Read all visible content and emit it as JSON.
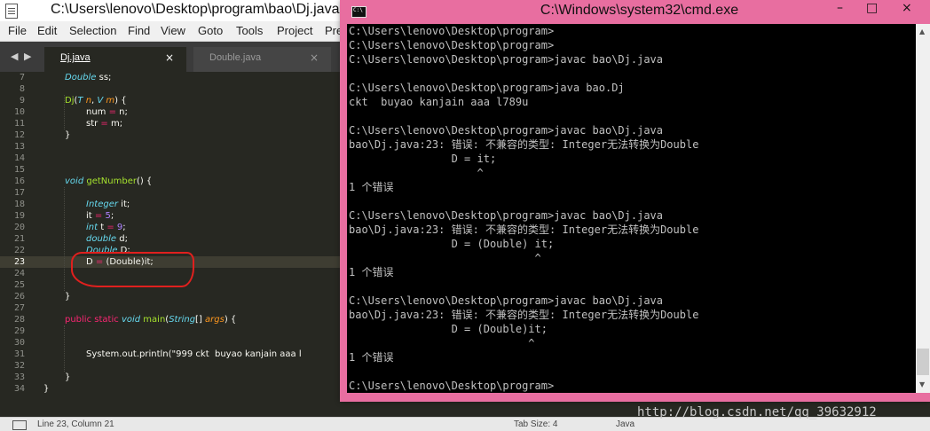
{
  "sublime": {
    "title": "C:\\Users\\lenovo\\Desktop\\program\\bao\\Dj.java",
    "menu": [
      "File",
      "Edit",
      "Selection",
      "Find",
      "View",
      "Goto",
      "Tools",
      "Project",
      "Pre"
    ],
    "tab_nav_left": "◀",
    "tab_nav_right": "▶",
    "tabs": [
      {
        "label": "Dj.java",
        "close": "×"
      },
      {
        "label": "Double.java",
        "close": "×"
      }
    ],
    "line_numbers": [
      "7",
      "8",
      "9",
      "10",
      "11",
      "12",
      "13",
      "14",
      "15",
      "16",
      "17",
      "18",
      "19",
      "20",
      "21",
      "22",
      "23",
      "24",
      "25",
      "26",
      "27",
      "28",
      "29",
      "30",
      "31",
      "32",
      "33",
      "34"
    ],
    "current_line": "23",
    "status": {
      "position": "Line 23, Column 21",
      "tab_size": "Tab Size: 4",
      "syntax": "Java"
    }
  },
  "code": {
    "l7_type": "Double",
    "l7_rest": " ss;",
    "l9_fn": "Dj",
    "l9_p1": "(",
    "l9_t1": "T",
    "l9_a1": "n",
    "l9_p2": ", ",
    "l9_t2": "V",
    "l9_a2": "m",
    "l9_p3": ") {",
    "l10_a": "num ",
    "l10_op": "=",
    "l10_b": " n;",
    "l11_a": "str ",
    "l11_op": "=",
    "l11_b": " m;",
    "l12": "}",
    "l16_kw": "void",
    "l16_fn": "getNumber",
    "l16_rest": "() {",
    "l18_type": "Integer",
    "l18_rest": " it;",
    "l19_a": "it ",
    "l19_op": "=",
    "l19_num": "5",
    "l19_b": ";",
    "l20_kw": "int",
    "l20_a": " t ",
    "l20_op": "=",
    "l20_num": "9",
    "l20_b": ";",
    "l21_kw": "double",
    "l21_rest": " d;",
    "l22_type": "Double",
    "l22_rest": " D;",
    "l23_a": "D ",
    "l23_op": "=",
    "l23_b": " (Double)it;",
    "l26": "}",
    "l28_kw1": "public",
    "l28_kw2": "static",
    "l28_kw3": "void",
    "l28_fn": "main",
    "l28_p1": "(",
    "l28_type": "String",
    "l28_p2": "[] ",
    "l28_arg": "args",
    "l28_p3": ") {",
    "l31": "System.out.println(\"999 ckt  buyao kanjain aaa l",
    "l33": "}",
    "l34": "}"
  },
  "cmd": {
    "title": "C:\\Windows\\system32\\cmd.exe",
    "minimize": "–",
    "maximize": "□",
    "close": "×",
    "lines": [
      "C:\\Users\\lenovo\\Desktop\\program>",
      "C:\\Users\\lenovo\\Desktop\\program>",
      "C:\\Users\\lenovo\\Desktop\\program>javac bao\\Dj.java",
      "",
      "C:\\Users\\lenovo\\Desktop\\program>java bao.Dj",
      "ckt  buyao kanjain aaa l789u",
      "",
      "C:\\Users\\lenovo\\Desktop\\program>javac bao\\Dj.java",
      "bao\\Dj.java:23: 错误: 不兼容的类型: Integer无法转换为Double",
      "                D = it;",
      "                    ^",
      "1 个错误",
      "",
      "C:\\Users\\lenovo\\Desktop\\program>javac bao\\Dj.java",
      "bao\\Dj.java:23: 错误: 不兼容的类型: Integer无法转换为Double",
      "                D = (Double) it;",
      "                             ^",
      "1 个错误",
      "",
      "C:\\Users\\lenovo\\Desktop\\program>javac bao\\Dj.java",
      "bao\\Dj.java:23: 错误: 不兼容的类型: Integer无法转换为Double",
      "                D = (Double)it;",
      "                            ^",
      "1 个错误",
      "",
      "C:\\Users\\lenovo\\Desktop\\program>"
    ],
    "scroll_up": "▲",
    "scroll_down": "▼"
  },
  "watermark": "http://blog.csdn.net/qq_39632912",
  "colors": {
    "editor_bg": "#272822",
    "cmd_frame": "#e86ea0",
    "annotation": "#e0201e"
  }
}
